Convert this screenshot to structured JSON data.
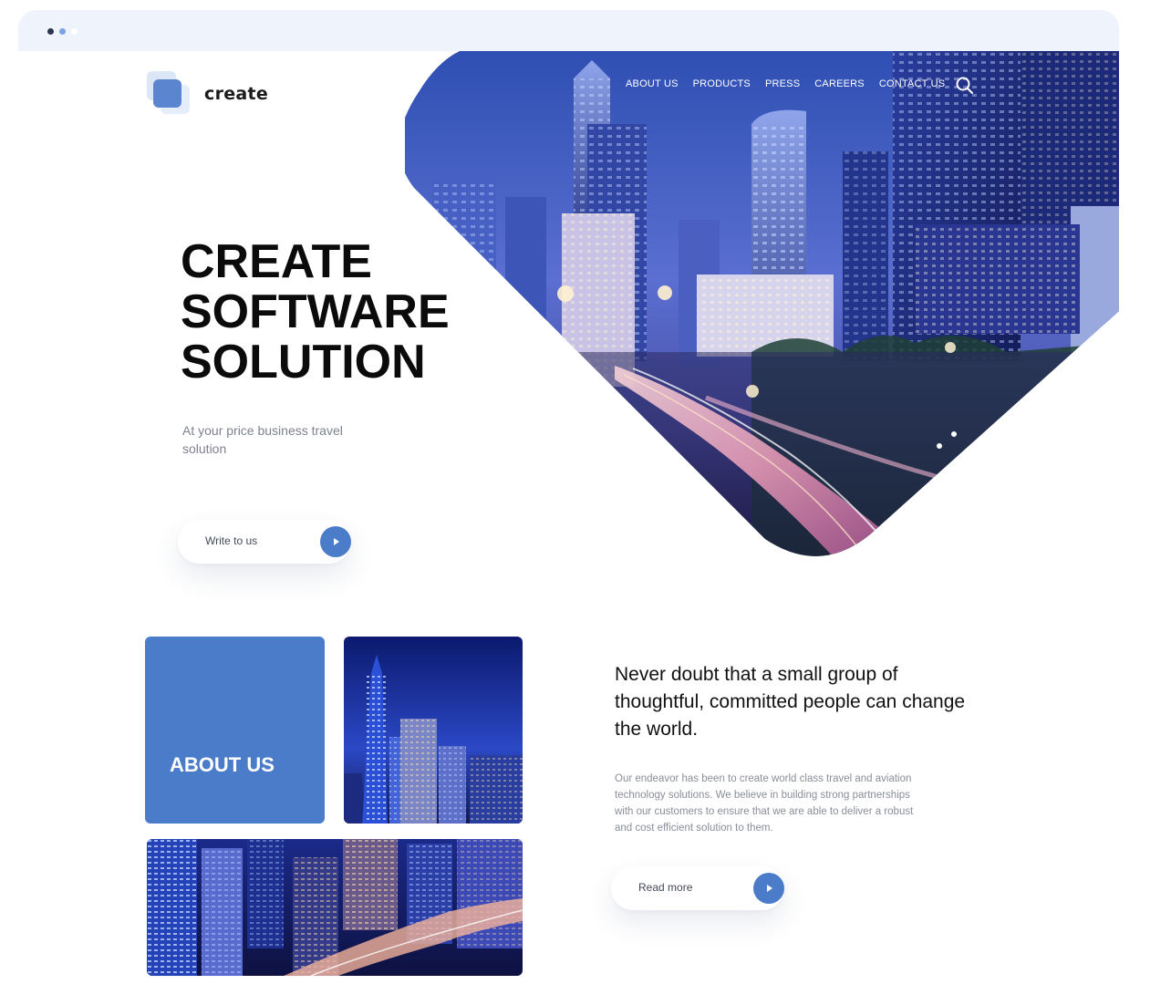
{
  "brand": {
    "name": "create"
  },
  "nav": {
    "items": [
      {
        "label": "ABOUT US"
      },
      {
        "label": "PRODUCTS"
      },
      {
        "label": "PRESS"
      },
      {
        "label": "CAREERS"
      },
      {
        "label": "CONTACT US"
      }
    ],
    "search_icon": "search-icon"
  },
  "hero": {
    "title_lines": [
      "CREATE",
      "SOFTWARE",
      "SOLUTION"
    ],
    "subtitle": "At your price business travel solution",
    "cta_label": "Write to us",
    "image": "city-night-highway-photo"
  },
  "about": {
    "card_label": "ABOUT US",
    "images": [
      "night-tower-photo",
      "city-aerial-photo"
    ],
    "quote": "Never doubt that a small group of thoughtful, committed people can change the world.",
    "body": "Our endeavor has been to create world class travel and aviation technology solutions. We believe in building strong partnerships with our customers to ensure that we are able to deliver a robust and cost efficient solution to them.",
    "cta_label": "Read more"
  },
  "colors": {
    "accent": "#4a7cc9",
    "browser_bar": "#eef3fc",
    "heading": "#0b0b0b",
    "muted": "#8a8e99"
  }
}
